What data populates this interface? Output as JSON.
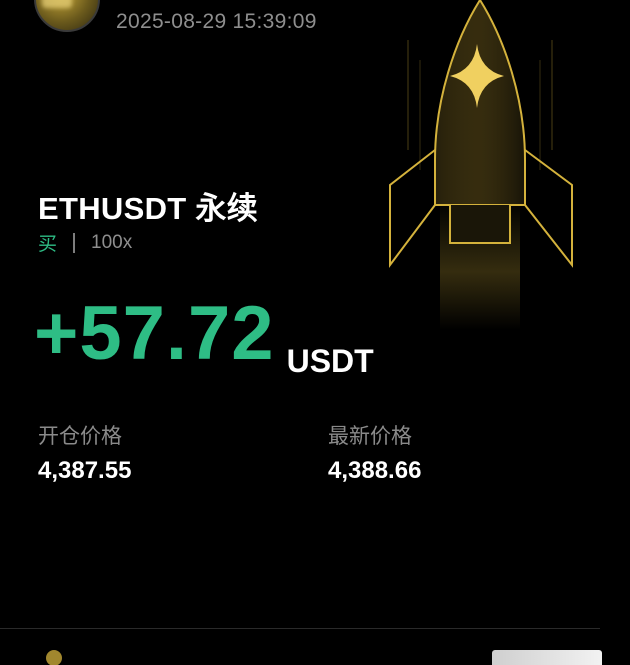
{
  "header": {
    "timestamp": "2025-08-29 15:39:09"
  },
  "position": {
    "symbol": "ETHUSDT 永续",
    "side": "买",
    "leverage": "100x",
    "pnl": "+57.72",
    "pnl_unit": "USDT"
  },
  "prices": {
    "entry_label": "开仓价格",
    "entry_value": "4,387.55",
    "last_label": "最新价格",
    "last_value": "4,388.66"
  },
  "colors": {
    "profit": "#2ebd85",
    "accent_gold": "#d4b23c",
    "background": "#000000",
    "muted_text": "#8e8e8e"
  },
  "icons": {
    "decoration": "rocket-icon",
    "avatar": "avatar"
  }
}
